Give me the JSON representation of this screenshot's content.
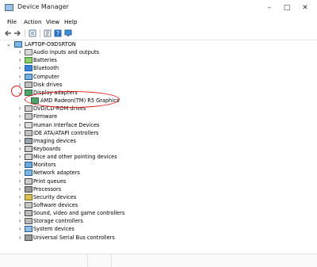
{
  "window": {
    "title": "Device Manager"
  },
  "menu": [
    "File",
    "Action",
    "View",
    "Help"
  ],
  "toolbar": {
    "icons": [
      "back-arrow-icon",
      "forward-arrow-icon",
      "device-view-icon",
      "properties-icon",
      "help-icon",
      "monitor-icon"
    ]
  },
  "tree": {
    "root": "LAPTOP-O9DSRTON",
    "categories": [
      "Audio inputs and outputs",
      "Batteries",
      "Bluetooth",
      "Computer",
      "Disk drives",
      "Display adapters",
      "DVD/CD-ROM drives",
      "Firmware",
      "Human Interface Devices",
      "IDE ATA/ATAPI controllers",
      "Imaging devices",
      "Keyboards",
      "Mice and other pointing devices",
      "Monitors",
      "Network adapters",
      "Print queues",
      "Processors",
      "Security devices",
      "Software devices",
      "Sound, video and game controllers",
      "Storage controllers",
      "System devices",
      "Universal Serial Bus controllers"
    ],
    "expanded_index": 5,
    "child": "AMD Radeon(TM) R5 Graphics"
  },
  "colors": {
    "annotation": "#e0161b",
    "selection": "#cce8ff"
  }
}
